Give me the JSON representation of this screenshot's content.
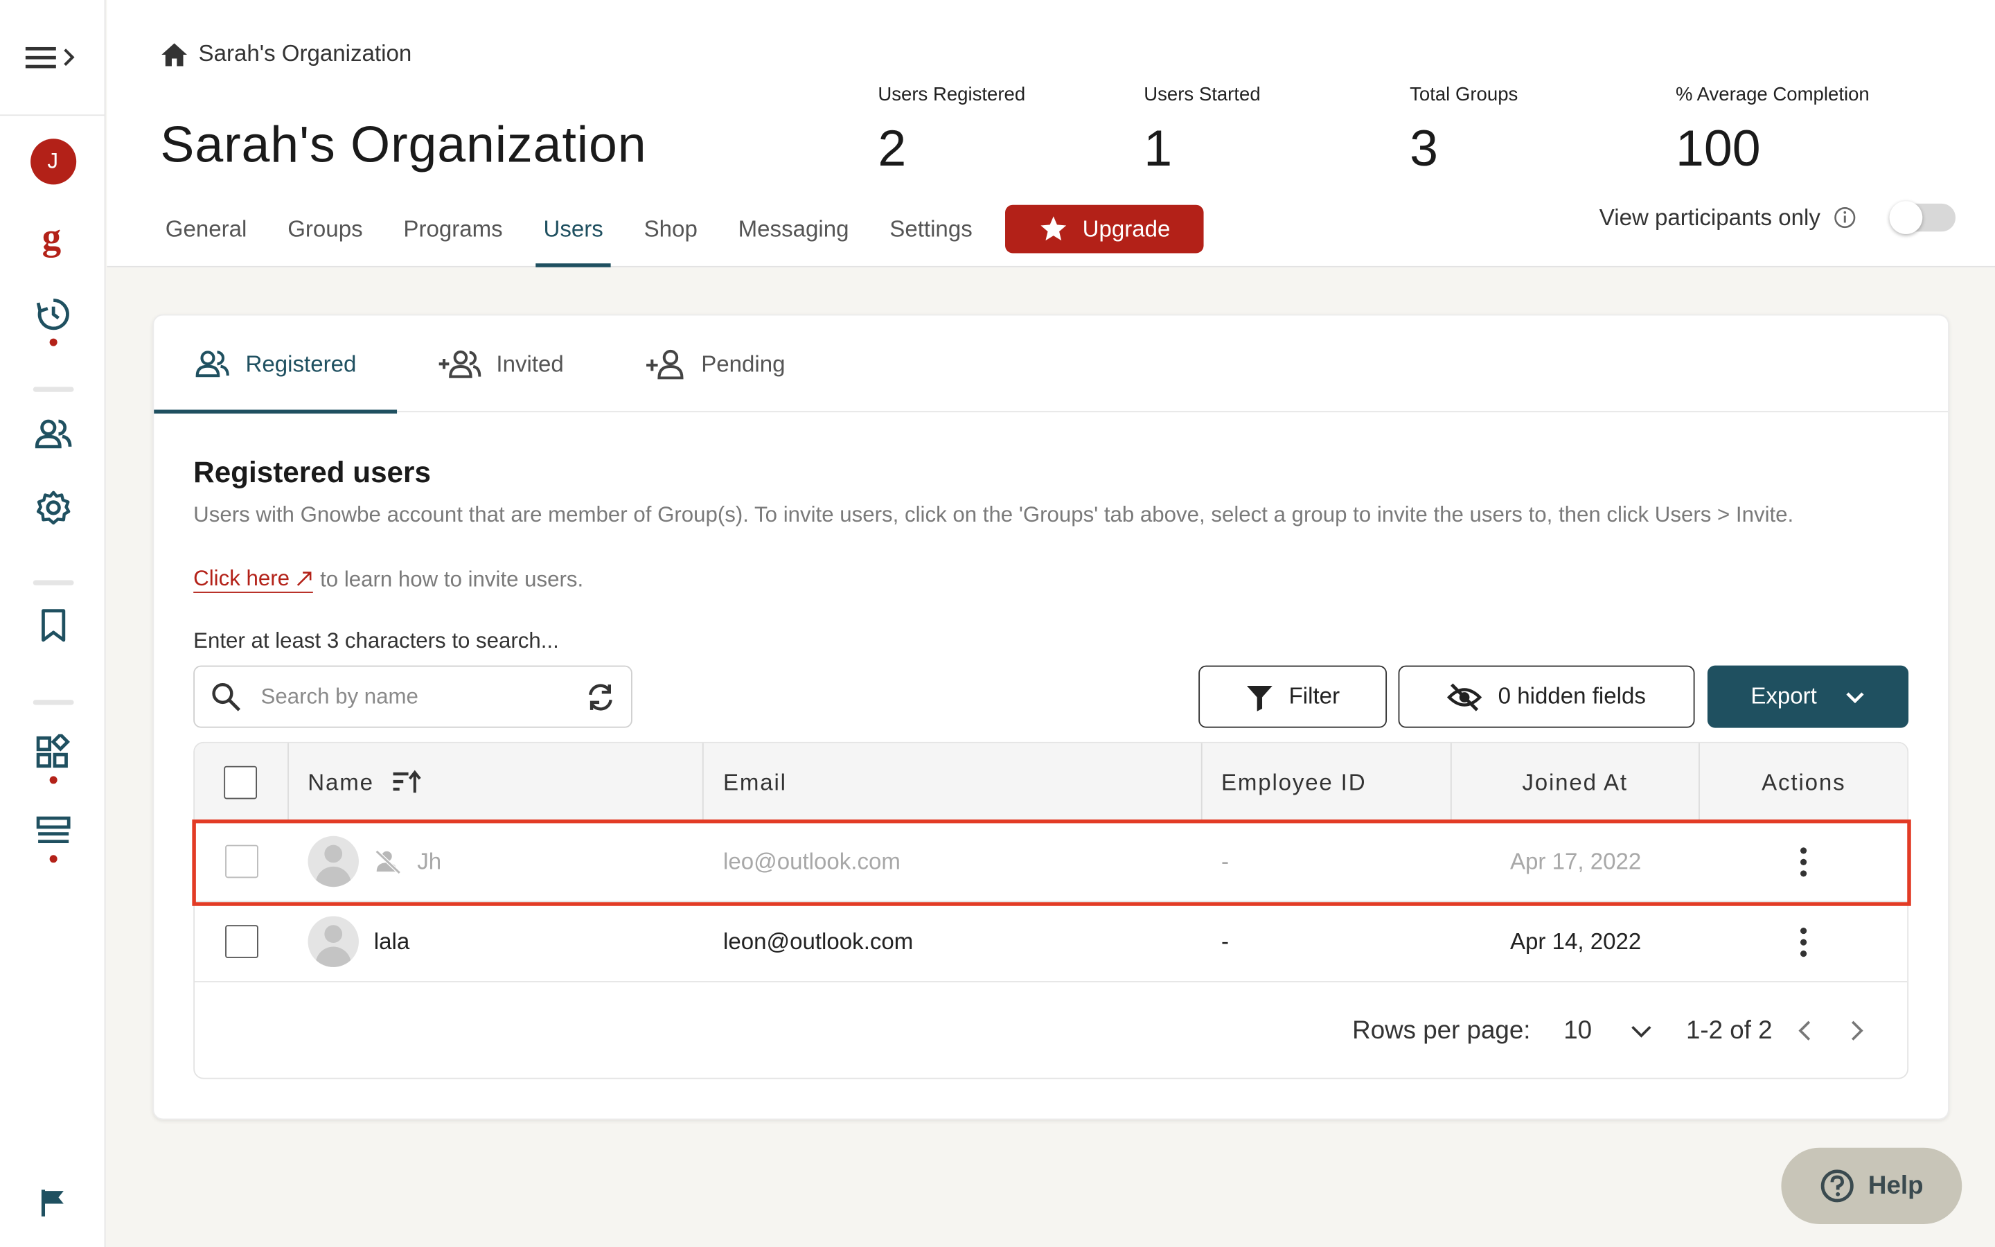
{
  "sidebar": {
    "avatar_letter": "J"
  },
  "breadcrumb": {
    "label": "Sarah's Organization"
  },
  "org_title": "Sarah's Organization",
  "stats": [
    {
      "label": "Users Registered",
      "value": "2"
    },
    {
      "label": "Users Started",
      "value": "1"
    },
    {
      "label": "Total Groups",
      "value": "3"
    },
    {
      "label": "% Average Completion",
      "value": "100"
    }
  ],
  "nav": {
    "tabs": [
      "General",
      "Groups",
      "Programs",
      "Users",
      "Shop",
      "Messaging",
      "Settings"
    ],
    "active": "Users",
    "upgrade_label": "Upgrade"
  },
  "view_participants": {
    "label": "View participants only",
    "enabled": false
  },
  "subtabs": [
    "Registered",
    "Invited",
    "Pending"
  ],
  "section": {
    "title": "Registered users",
    "description": "Users with Gnowbe account that are member of Group(s). To invite users, click on the 'Groups' tab above, select a group to invite the users to, then click Users > Invite.",
    "link_label": "Click here",
    "link_suffix": "to learn how to invite users.",
    "search_hint": "Enter at least 3 characters to search...",
    "search_placeholder": "Search by name"
  },
  "toolbar": {
    "filter_label": "Filter",
    "hidden_fields_label": "0 hidden fields",
    "export_label": "Export"
  },
  "table": {
    "columns": [
      "Name",
      "Email",
      "Employee ID",
      "Joined At",
      "Actions"
    ],
    "rows": [
      {
        "name": "Jh",
        "email": "leo@outlook.com",
        "employee_id": "-",
        "joined_at": "Apr 17, 2022",
        "inactive": true
      },
      {
        "name": "lala",
        "email": "leon@outlook.com",
        "employee_id": "-",
        "joined_at": "Apr 14, 2022",
        "inactive": false
      }
    ]
  },
  "pagination": {
    "rows_per_page_label": "Rows per page:",
    "rows_per_page": "10",
    "range": "1-2 of 2"
  },
  "help": {
    "label": "Help"
  },
  "colors": {
    "brand_red": "#b32118",
    "teal": "#1f5060",
    "highlight": "#e23b25"
  }
}
